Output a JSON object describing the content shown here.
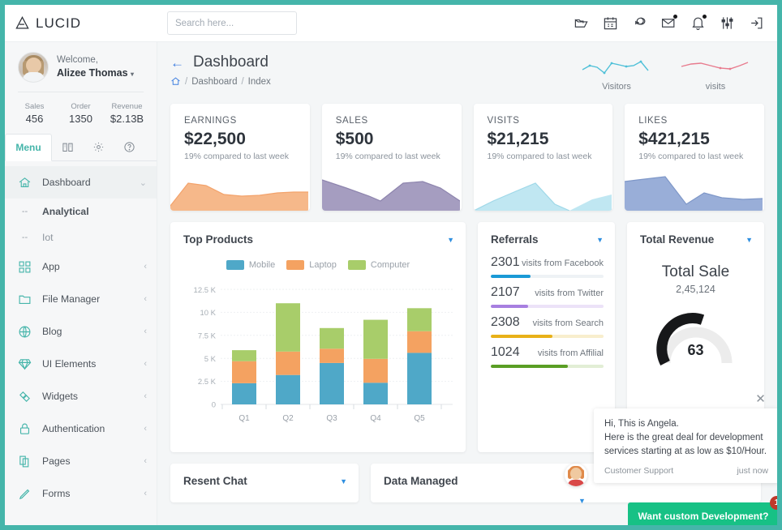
{
  "brand": {
    "name": "LUCID",
    "logo_icon": "triangle-a-logo"
  },
  "search": {
    "placeholder": "Search here...",
    "value": "",
    "icon": "search-icon"
  },
  "top_icons": [
    {
      "name": "folder-open-icon",
      "badge": false
    },
    {
      "name": "calendar-icon",
      "badge": false
    },
    {
      "name": "chat-bubbles-icon",
      "badge": false
    },
    {
      "name": "mail-icon",
      "badge": true
    },
    {
      "name": "bell-icon",
      "badge": true
    },
    {
      "name": "sliders-icon",
      "badge": false
    },
    {
      "name": "logout-icon",
      "badge": false
    }
  ],
  "sidebar": {
    "welcome_label": "Welcome,",
    "user_name": "Alizee Thomas",
    "stats": [
      {
        "label": "Sales",
        "value": "456"
      },
      {
        "label": "Order",
        "value": "1350"
      },
      {
        "label": "Revenue",
        "value": "$2.13B"
      }
    ],
    "tabs": [
      {
        "label": "Menu",
        "icon": "",
        "active": true
      },
      {
        "label": "",
        "icon": "book-icon",
        "active": false
      },
      {
        "label": "",
        "icon": "gear-icon",
        "active": false
      },
      {
        "label": "",
        "icon": "help-circle-icon",
        "active": false
      }
    ],
    "items": [
      {
        "label": "Dashboard",
        "icon": "home-icon",
        "arrow": "chevron-down-icon",
        "active": true
      },
      {
        "label": "Analytical",
        "icon": "dash-icon",
        "sub": true,
        "bold": true
      },
      {
        "label": "Iot",
        "icon": "dash-icon",
        "sub": true,
        "bold": false
      },
      {
        "label": "App",
        "icon": "grid-icon",
        "arrow": "chevron-left-icon"
      },
      {
        "label": "File Manager",
        "icon": "folder-icon",
        "arrow": "chevron-left-icon"
      },
      {
        "label": "Blog",
        "icon": "globe-icon",
        "arrow": "chevron-left-icon"
      },
      {
        "label": "UI Elements",
        "icon": "diamond-icon",
        "arrow": "chevron-left-icon"
      },
      {
        "label": "Widgets",
        "icon": "widgets-icon",
        "arrow": "chevron-left-icon"
      },
      {
        "label": "Authentication",
        "icon": "lock-icon",
        "arrow": "chevron-left-icon"
      },
      {
        "label": "Pages",
        "icon": "pages-icon",
        "arrow": "chevron-left-icon"
      },
      {
        "label": "Forms",
        "icon": "pencil-icon",
        "arrow": "chevron-left-icon"
      }
    ]
  },
  "page": {
    "title": "Dashboard",
    "back_icon": "arrow-left-icon",
    "breadcrumb": {
      "home_icon": "home-icon",
      "items": [
        "Dashboard",
        "Index"
      ],
      "separator": "/"
    }
  },
  "header_sparklines": [
    {
      "label": "Visitors",
      "color": "#4fc0d8",
      "points": [
        14,
        9,
        12,
        18,
        6,
        14,
        12,
        13,
        11,
        17,
        8
      ]
    },
    {
      "label": "visits",
      "color": "#e87b8e",
      "points": [
        9,
        13,
        14,
        12,
        8,
        7,
        7,
        9,
        12,
        15
      ]
    }
  ],
  "kpis": [
    {
      "title": "EARNINGS",
      "value": "$22,500",
      "sub": "19% compared to last week",
      "color": "#f2a975",
      "points": [
        2,
        16,
        15,
        11,
        8,
        8,
        9,
        10,
        10,
        11
      ]
    },
    {
      "title": "SALES",
      "value": "$500",
      "sub": "19% compared to last week",
      "color": "#9b93b8",
      "points": [
        14,
        11,
        8,
        5,
        3,
        10,
        16,
        15,
        14,
        6
      ]
    },
    {
      "title": "VISITS",
      "value": "$21,215",
      "sub": "19% compared to last week",
      "color": "#b7e4ef",
      "points": [
        0,
        4,
        8,
        11,
        14,
        16,
        10,
        2,
        5,
        8
      ]
    },
    {
      "title": "LIKES",
      "value": "$421,215",
      "sub": "19% compared to last week",
      "color": "#8fa8d4",
      "points": [
        15,
        16,
        15,
        9,
        2,
        7,
        9,
        6,
        5,
        6
      ]
    }
  ],
  "top_products": {
    "title": "Top Products",
    "caret_icon": "caret-down-icon"
  },
  "chart_data": {
    "type": "bar",
    "stacked": true,
    "title": "Top Products",
    "categories": [
      "Q1",
      "Q2",
      "Q3",
      "Q4",
      "Q5"
    ],
    "series": [
      {
        "name": "Mobile",
        "color": "#4fa8c8",
        "values": [
          2300,
          3200,
          4500,
          2350,
          5600
        ]
      },
      {
        "name": "Laptop",
        "color": "#f4a261",
        "values": [
          2400,
          2550,
          1550,
          2600,
          2350
        ]
      },
      {
        "name": "Computer",
        "color": "#a8cd6a",
        "values": [
          1200,
          5250,
          2250,
          4250,
          2500
        ]
      }
    ],
    "ylim": [
      0,
      12500
    ],
    "yticks": [
      0,
      2500,
      5000,
      7500,
      10000,
      12500
    ],
    "ytick_labels": [
      "0",
      "2.5 K",
      "5 K",
      "7.5 K",
      "10 K",
      "12.5 K"
    ],
    "xlabel": "",
    "ylabel": "",
    "grid": true,
    "legend_position": "top"
  },
  "referrals": {
    "title": "Referrals",
    "caret_icon": "caret-down-icon",
    "items": [
      {
        "value": "2301",
        "label": "visits from Facebook",
        "color": "#1a9ad6",
        "track": "#d8eef8",
        "percent": 35
      },
      {
        "value": "2107",
        "label": "visits from Twitter",
        "color": "#a77fe0",
        "track": "#ece2f8",
        "percent": 33
      },
      {
        "value": "2308",
        "label": "visits from Search",
        "color": "#e8b118",
        "track": "#f8eecd",
        "percent": 55
      },
      {
        "value": "1024",
        "label": "visits from Affilial",
        "color": "#5a9e24",
        "track": "#e2eed5",
        "percent": 68
      }
    ]
  },
  "total_revenue": {
    "title": "Total Revenue",
    "caret_icon": "caret-down-icon",
    "headline": "Total Sale",
    "amount": "2,45,124",
    "gauge_value": "63",
    "gauge_percent": 63,
    "gauge_color": "#17181a",
    "gauge_track": "#ececec"
  },
  "bottom_panels": [
    {
      "title": "Resent Chat",
      "caret_icon": "caret-down-icon",
      "has_caret": true
    },
    {
      "title": "Data Managed",
      "caret_icon": "caret-down-icon",
      "has_caret": false
    }
  ],
  "chat_widget": {
    "close_icon": "close-icon",
    "lines": [
      "Hi, This is Angela.",
      "Here is the great deal for development",
      "services starting at as low as $10/Hour."
    ],
    "sender": "Customer Support",
    "time": "just now",
    "cta_label": "Want custom Development?",
    "cta_badge": "1"
  },
  "colors": {
    "accent": "#45b5aa",
    "cta": "#17c185",
    "link": "#3f7fe0",
    "badge": "#c0392b"
  }
}
